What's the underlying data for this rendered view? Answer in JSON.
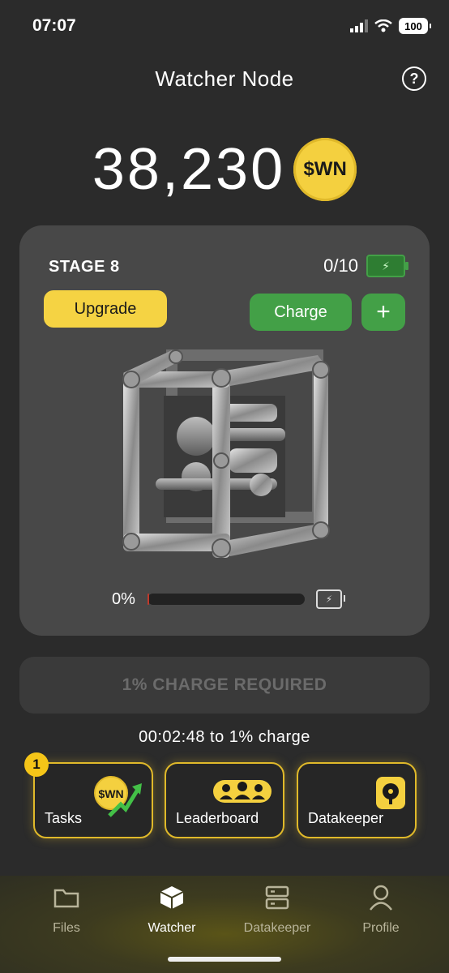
{
  "status_bar": {
    "time": "07:07",
    "battery": "100"
  },
  "header": {
    "title": "Watcher Node",
    "help_icon": "?"
  },
  "balance": {
    "amount": "38,230",
    "token": "$WN"
  },
  "stage_card": {
    "stage_label": "STAGE 8",
    "energy": "0/10",
    "upgrade_label": "Upgrade",
    "charge_label": "Charge",
    "add_label": "+",
    "progress_label": "0%",
    "progress_value": 0.01
  },
  "charge_required_label": "1% CHARGE REQUIRED",
  "countdown": "00:02:48 to 1% charge",
  "tiles": [
    {
      "label": "Tasks",
      "badge": "1",
      "icon_text": "$WN"
    },
    {
      "label": "Leaderboard"
    },
    {
      "label": "Datakeeper"
    }
  ],
  "nav": [
    {
      "label": "Files"
    },
    {
      "label": "Watcher"
    },
    {
      "label": "Datakeeper"
    },
    {
      "label": "Profile"
    }
  ],
  "colors": {
    "accent_yellow": "#f5d343",
    "accent_green": "#43a047"
  }
}
